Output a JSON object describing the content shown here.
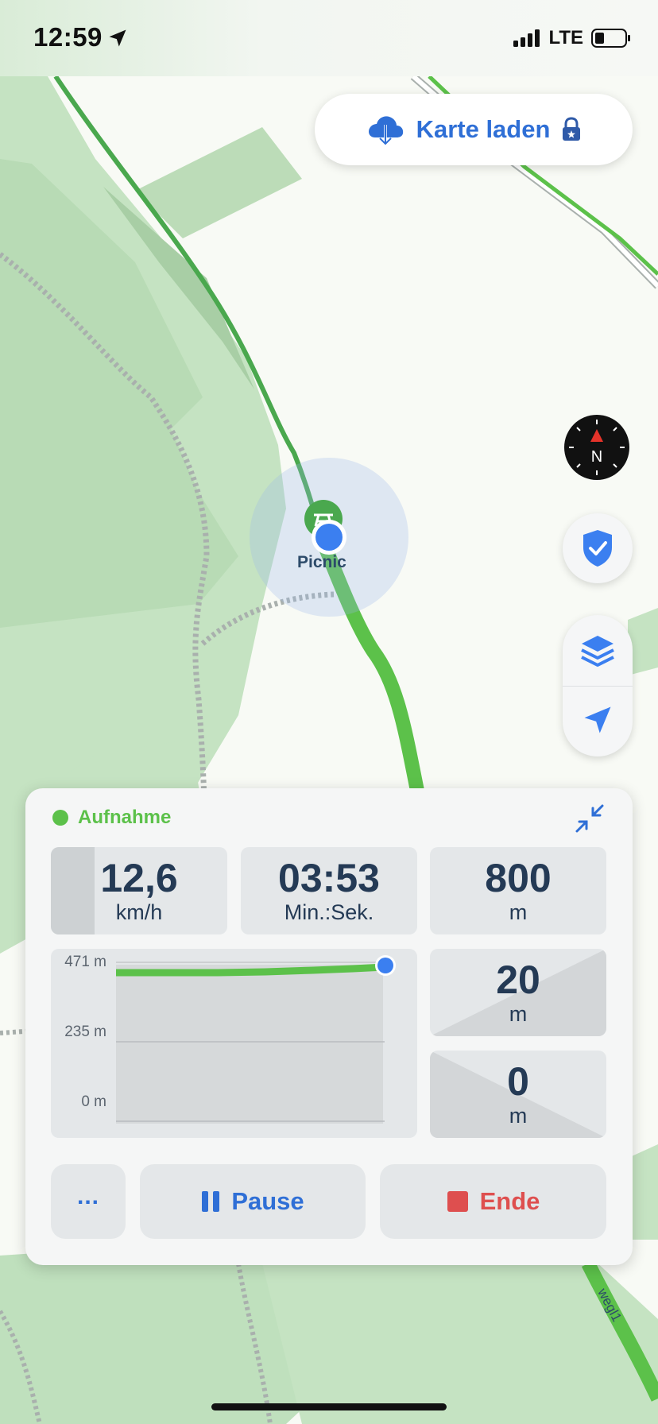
{
  "status_bar": {
    "time": "12:59",
    "network": "LTE",
    "location_icon": "location-arrow-icon",
    "battery_level": 0.25
  },
  "map": {
    "load_button_label": "Karte laden",
    "poi_label": "Picnic",
    "road_label": "wegl1"
  },
  "controls": {
    "compass_label": "N",
    "icons": [
      "compass-icon",
      "shield-check-icon",
      "layers-icon",
      "navigation-arrow-icon"
    ]
  },
  "recording": {
    "status": "Aufnahme",
    "speed": {
      "value": "12,6",
      "unit": "km/h"
    },
    "duration": {
      "value": "03:53",
      "unit": "Min.:Sek."
    },
    "distance": {
      "value": "800",
      "unit": "m"
    },
    "ascent": {
      "value": "20",
      "unit": "m"
    },
    "descent": {
      "value": "0",
      "unit": "m"
    },
    "elevation_axis": [
      "471 m",
      "235 m",
      "0 m"
    ],
    "buttons": {
      "more": "...",
      "pause": "Pause",
      "end": "Ende"
    }
  },
  "colors": {
    "accent_blue": "#2f6fd6",
    "recording_green": "#5cc14a",
    "stop_red": "#de4f4f",
    "route_green": "#5cc14a",
    "map_green": "#bfe0bd"
  }
}
